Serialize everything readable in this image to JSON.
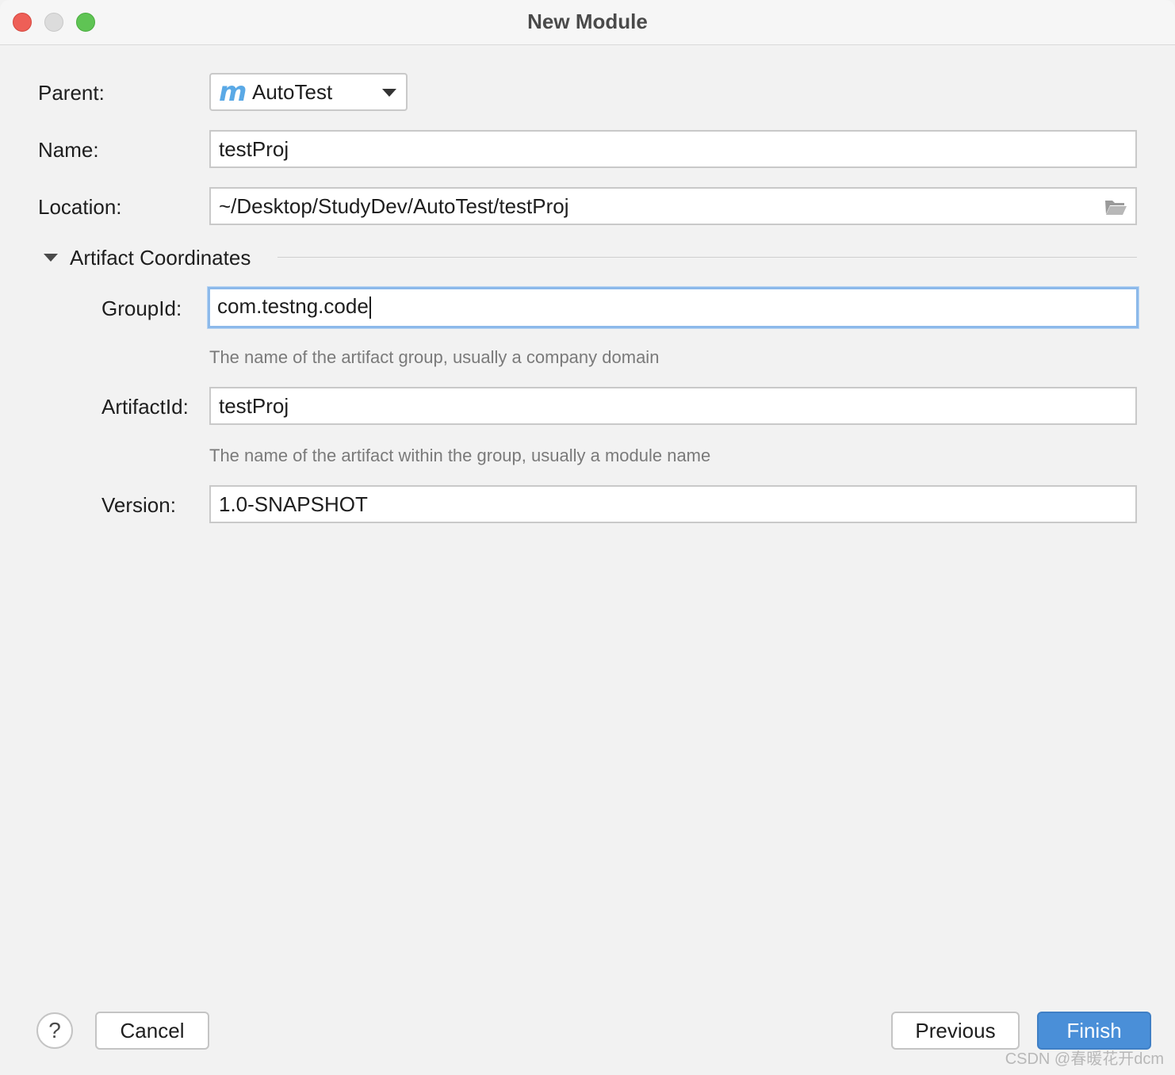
{
  "window": {
    "title": "New Module"
  },
  "form": {
    "parent_label": "Parent:",
    "parent_value": "AutoTest",
    "name_label": "Name:",
    "name_value": "testProj",
    "location_label": "Location:",
    "location_value": "~/Desktop/StudyDev/AutoTest/testProj"
  },
  "artifact": {
    "section_title": "Artifact Coordinates",
    "group_label": "GroupId:",
    "group_value": "com.testng.code",
    "group_hint": "The name of the artifact group, usually a company domain",
    "artifact_label": "ArtifactId:",
    "artifact_value": "testProj",
    "artifact_hint": "The name of the artifact within the group, usually a module name",
    "version_label": "Version:",
    "version_value": "1.0-SNAPSHOT"
  },
  "footer": {
    "help_label": "?",
    "cancel_label": "Cancel",
    "previous_label": "Previous",
    "finish_label": "Finish"
  },
  "watermark": "CSDN @春暖花开dcm",
  "colors": {
    "accent": "#4a8fd8",
    "focus_ring": "#8cb9ea",
    "maven_icon": "#5aa9e6"
  }
}
